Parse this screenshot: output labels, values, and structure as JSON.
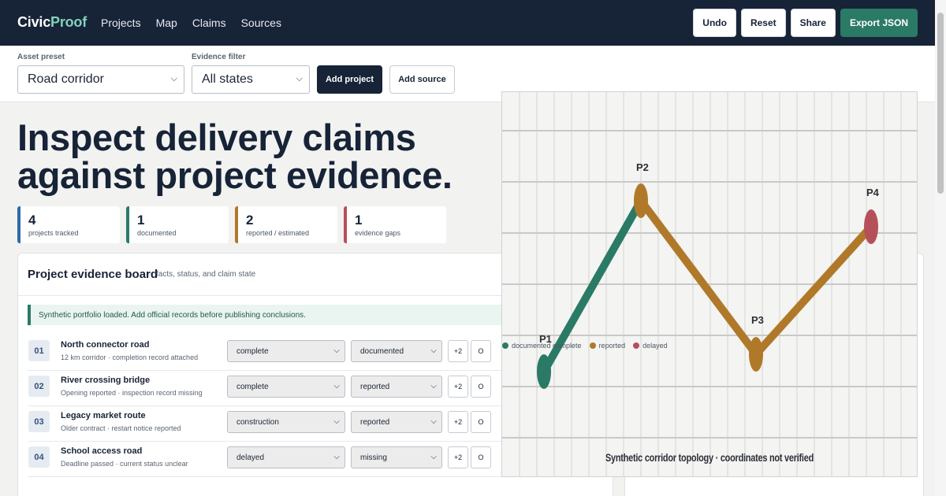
{
  "brand": {
    "part1": "Civic",
    "part2": "Proof"
  },
  "nav": [
    "Projects",
    "Map",
    "Claims",
    "Sources"
  ],
  "header_buttons": {
    "undo": "Undo",
    "reset": "Reset",
    "share": "Share",
    "export": "Export JSON"
  },
  "controls": {
    "asset_label": "Asset preset",
    "asset_value": "Road corridor",
    "evidence_label": "Evidence filter",
    "evidence_value": "All states",
    "add_project": "Add project",
    "add_source": "Add source"
  },
  "hero": {
    "line1": "Inspect delivery claims",
    "line2": "against project evidence."
  },
  "stats": [
    {
      "value": "4",
      "label": "projects tracked",
      "color": "#2f6aa8"
    },
    {
      "value": "1",
      "label": "documented",
      "color": "#2a7a66"
    },
    {
      "value": "2",
      "label": "reported / estimated",
      "color": "#b0792a"
    },
    {
      "value": "1",
      "label": "evidence gaps",
      "color": "#b5505a"
    }
  ],
  "board": {
    "title": "Project evidence board",
    "subtitle": "facts, status, and claim state",
    "notice": "Synthetic portfolio loaded. Add official records before publishing conclusions.",
    "rows": [
      {
        "idx": "01",
        "name": "North connector road",
        "sub": "12 km corridor · completion record attached",
        "status": "complete",
        "evidence": "documented",
        "more": "+2",
        "o": "O"
      },
      {
        "idx": "02",
        "name": "River crossing bridge",
        "sub": "Opening reported · inspection record missing",
        "status": "complete",
        "evidence": "reported",
        "more": "+2",
        "o": "O"
      },
      {
        "idx": "03",
        "name": "Legacy market route",
        "sub": "Older contract · restart notice reported",
        "status": "construction",
        "evidence": "reported",
        "more": "+2",
        "o": "O"
      },
      {
        "idx": "04",
        "name": "School access road",
        "sub": "Deadline passed · current status unclear",
        "status": "delayed",
        "evidence": "missing",
        "more": "+2",
        "o": "O"
      }
    ]
  },
  "map": {
    "points": [
      "P1",
      "P2",
      "P3",
      "P4"
    ],
    "legend": [
      {
        "label": "documented complete",
        "color": "#2a7a66"
      },
      {
        "label": "reported",
        "color": "#b0792a"
      },
      {
        "label": "delayed",
        "color": "#b5505a"
      }
    ],
    "caption": "Synthetic corridor topology · coordinates not verified"
  },
  "icons": {
    "chevron": "chevron-down-icon"
  }
}
